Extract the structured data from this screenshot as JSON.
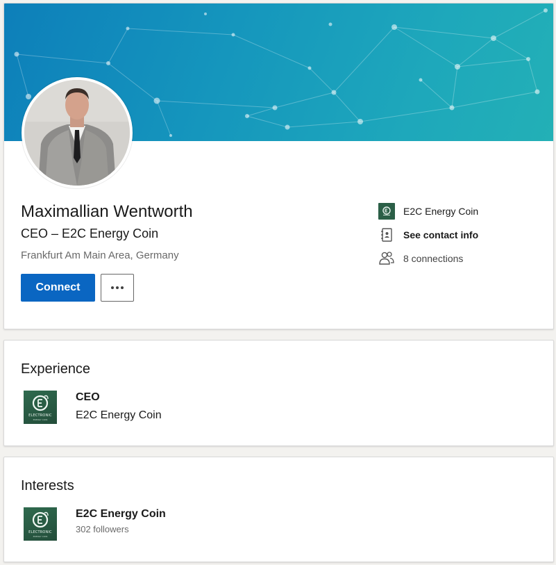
{
  "profile": {
    "name": "Maximallian Wentworth",
    "headline": "CEO – E2C Energy Coin",
    "location": "Frankfurt Am Main Area, Germany",
    "connect_label": "Connect"
  },
  "sidebar": {
    "company": "E2C Energy Coin",
    "contact": "See contact info",
    "connections": "8 connections"
  },
  "experience": {
    "title": "Experience",
    "items": [
      {
        "role": "CEO",
        "company": "E2C Energy Coin",
        "logo_text": "ELECTRONIC",
        "logo_sub": "ENERGY COIN"
      }
    ]
  },
  "interests": {
    "title": "Interests",
    "items": [
      {
        "name": "E2C Energy Coin",
        "followers": "302 followers",
        "logo_text": "ELECTRONIC",
        "logo_sub": "ENERGY COIN"
      }
    ]
  },
  "colors": {
    "primary": "#0a66c2",
    "banner_start": "#0d7fba",
    "banner_end": "#23b0b6",
    "logo_green": "#2b5f47"
  },
  "icons": {
    "company": "company-logo-icon",
    "contact": "contact-book-icon",
    "connections": "people-icon",
    "more": "ellipsis-icon"
  }
}
